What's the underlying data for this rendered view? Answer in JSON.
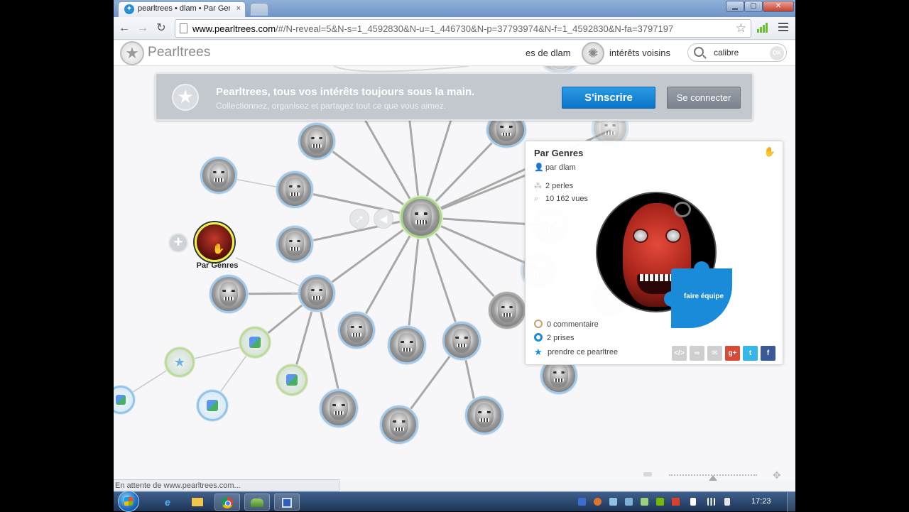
{
  "browser": {
    "tab_title": "pearltrees • dlam • Par Genres",
    "tab_close": "×",
    "url_host": "www.pearltrees.com",
    "url_path": "/#/N-reveal=5&N-s=1_4592830&N-u=1_446730&N-p=37793974&N-f=1_4592830&N-fa=3797197",
    "back": "←",
    "forward": "→",
    "reload": "↻",
    "window_min": "▁",
    "window_max": "▢",
    "window_close": "✕",
    "status_text": "En attente de www.pearltrees.com..."
  },
  "header": {
    "logo_text": "Pearltrees",
    "link_user": "es de dlam",
    "link_neighbors": "intérêts voisins",
    "search_value": "calibre",
    "search_ok": "OK"
  },
  "banner": {
    "title": "Pearltrees, tous vos intérêts toujours sous la main.",
    "subtitle": "Collectionnez, organisez et partagez tout ce que vous aimez.",
    "signup_label": "S'inscrire",
    "login_label": "Se connecter"
  },
  "graph": {
    "selected_label": "Par Genres",
    "plus": "+"
  },
  "detail": {
    "title": "Par Genres",
    "author": "par dlam",
    "pearls": "2 perles",
    "views": "10 162 vues",
    "badge": "faire équipe",
    "comments": "0 commentaire",
    "takes": "2 prises",
    "take_action": "prendre ce pearltree",
    "share_embed": "</>",
    "share_link": "∞",
    "share_mail": "✉",
    "share_gplus": "g+",
    "share_twitter": "t",
    "share_facebook": "f"
  },
  "zoom": {
    "level": 0.5
  },
  "taskbar": {
    "clock": "17:23"
  },
  "colors": {
    "accent_blue": "#0a74c9",
    "pearl_border": "#9fc9ea",
    "badge_blue": "#1a8bd9"
  }
}
